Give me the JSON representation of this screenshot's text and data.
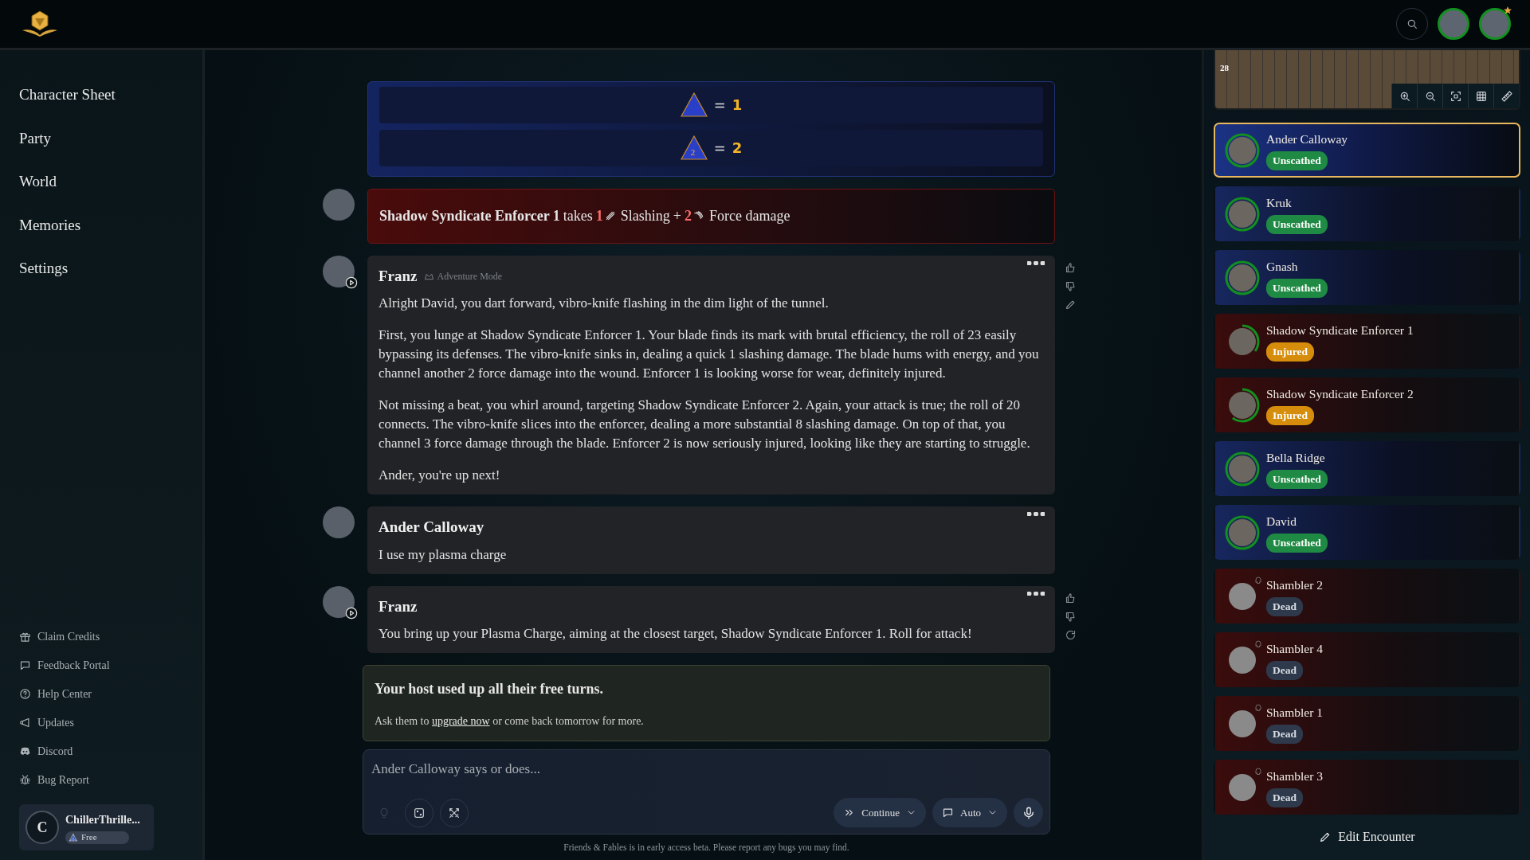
{
  "topbar": {
    "avatars": [
      {
        "starred": false
      },
      {
        "starred": true
      }
    ]
  },
  "sidebar": {
    "nav": [
      {
        "label": "Character Sheet"
      },
      {
        "label": "Party"
      },
      {
        "label": "World"
      },
      {
        "label": "Memories"
      },
      {
        "label": "Settings"
      }
    ],
    "links": [
      {
        "label": "Claim Credits"
      },
      {
        "label": "Feedback Portal"
      },
      {
        "label": "Help Center"
      },
      {
        "label": "Updates"
      },
      {
        "label": "Discord"
      },
      {
        "label": "Bug Report"
      }
    ],
    "user": {
      "initial": "C",
      "name": "ChillerThrille...",
      "plan": "Free"
    }
  },
  "chat": [
    {
      "kind": "dice",
      "rolls": [
        {
          "sign": "=",
          "value": "1"
        },
        {
          "face": "2",
          "sign": "=",
          "value": "2"
        }
      ]
    },
    {
      "kind": "damage",
      "narrator": false,
      "target": "Shadow Syndicate Enforcer 1",
      "verb": "takes",
      "parts": [
        {
          "amount": "1",
          "type": "Slashing"
        },
        {
          "joiner": "+",
          "amount": "2",
          "type": "Force damage"
        }
      ]
    },
    {
      "kind": "message",
      "author": "Franz",
      "mode": "Adventure Mode",
      "narrator": true,
      "feedback": true,
      "editable": true,
      "paragraphs": [
        "Alright David, you dart forward, vibro-knife flashing in the dim light of the tunnel.",
        "First, you lunge at Shadow Syndicate Enforcer 1. Your blade finds its mark with brutal efficiency, the roll of 23 easily bypassing its defenses. The vibro-knife sinks in, dealing a quick 1 slashing damage. The blade hums with energy, and you channel another 2 force damage into the wound. Enforcer 1 is looking worse for wear, definitely injured.",
        "Not missing a beat, you whirl around, targeting Shadow Syndicate Enforcer 2. Again, your attack is true; the roll of 20 connects. The vibro-knife slices into the enforcer, dealing a more substantial 8 slashing damage. On top of that, you channel 3 force damage through the blade. Enforcer 2 is now seriously injured, looking like they are starting to struggle.",
        "Ander, you're up next!"
      ]
    },
    {
      "kind": "message",
      "author": "Ander Calloway",
      "narrator": false,
      "paragraphs": [
        "I use my plasma charge"
      ]
    },
    {
      "kind": "message",
      "author": "Franz",
      "narrator": true,
      "feedback": true,
      "editable": false,
      "paragraphs": [
        "You bring up your Plasma Charge, aiming at the closest target, Shadow Syndicate Enforcer 1. Roll for attack!"
      ]
    }
  ],
  "notice": {
    "title": "Your host used up all their free turns.",
    "before": "Ask them to",
    "link": "upgrade now",
    "after": "or come back tomorrow for more."
  },
  "composer": {
    "placeholder": "Ander Calloway says or does...",
    "tools": [
      {
        "disabled": true
      },
      {
        "disabled": false
      },
      {
        "disabled": false
      }
    ],
    "dropdowns": [
      {
        "label": "Continue"
      },
      {
        "label": "Auto"
      }
    ]
  },
  "footer": "Friends & Fables is in early access beta. Please report any bugs you may find.",
  "map": {
    "label": "28"
  },
  "combatants": [
    {
      "name": "Ander Calloway",
      "kind": "ally",
      "selected": true,
      "level": 1,
      "status": {
        "label": "Unscathed",
        "kind": "healthy"
      }
    },
    {
      "name": "Kruk",
      "kind": "ally",
      "selected": false,
      "level": 1,
      "status": {
        "label": "Unscathed",
        "kind": "healthy"
      }
    },
    {
      "name": "Gnash",
      "kind": "ally",
      "selected": false,
      "level": 1,
      "status": {
        "label": "Unscathed",
        "kind": "healthy"
      }
    },
    {
      "name": "Shadow Syndicate Enforcer 1",
      "kind": "enemy",
      "selected": false,
      "level": 0.35,
      "status": {
        "label": "Injured",
        "kind": "injured"
      }
    },
    {
      "name": "Shadow Syndicate Enforcer 2",
      "kind": "enemy",
      "selected": false,
      "level": 0.6,
      "status": {
        "label": "Injured",
        "kind": "injured"
      }
    },
    {
      "name": "Bella Ridge",
      "kind": "ally",
      "selected": false,
      "level": 1,
      "status": {
        "label": "Unscathed",
        "kind": "healthy"
      }
    },
    {
      "name": "David",
      "kind": "ally",
      "selected": false,
      "level": 1,
      "status": {
        "label": "Unscathed",
        "kind": "healthy"
      }
    },
    {
      "name": "Shambler 2",
      "kind": "enemy",
      "selected": false,
      "level": 0,
      "status": {
        "label": "Dead",
        "kind": "dead"
      }
    },
    {
      "name": "Shambler 4",
      "kind": "enemy",
      "selected": false,
      "level": 0,
      "status": {
        "label": "Dead",
        "kind": "dead"
      }
    },
    {
      "name": "Shambler 1",
      "kind": "enemy",
      "selected": false,
      "level": 0,
      "status": {
        "label": "Dead",
        "kind": "dead"
      }
    },
    {
      "name": "Shambler 3",
      "kind": "enemy",
      "selected": false,
      "level": 0,
      "status": {
        "label": "Dead",
        "kind": "dead"
      }
    }
  ],
  "edit_button": "Edit Encounter"
}
